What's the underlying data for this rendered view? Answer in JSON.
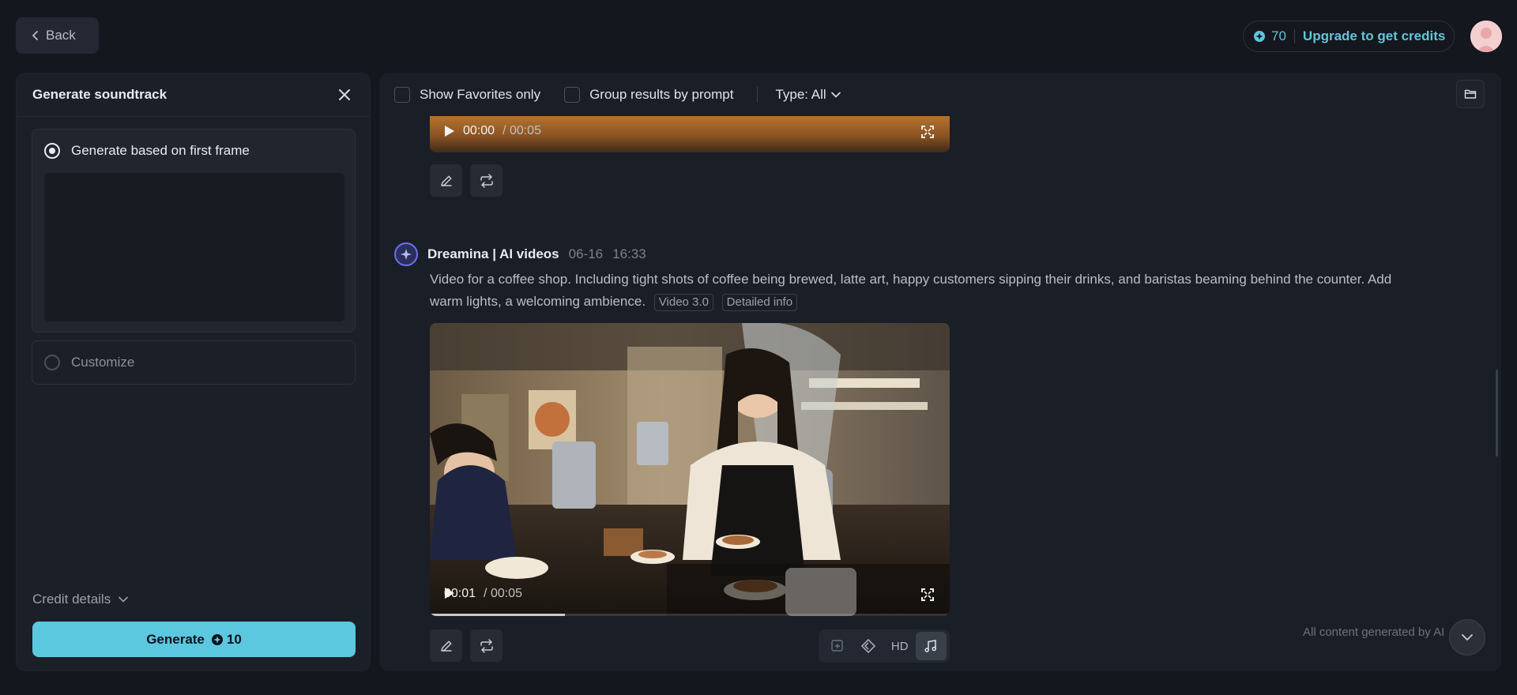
{
  "topbar": {
    "back_label": "Back",
    "credits_count": "70",
    "upgrade_label": "Upgrade to get credits"
  },
  "left_panel": {
    "title": "Generate soundtrack",
    "option_first_frame": "Generate based on first frame",
    "option_customize": "Customize",
    "credit_details_label": "Credit details",
    "generate_label": "Generate",
    "generate_cost": "10"
  },
  "filters": {
    "favorites_label": "Show Favorites only",
    "group_label": "Group results by prompt",
    "type_label": "Type: All"
  },
  "video1": {
    "current": "00:00",
    "duration": "/ 00:05"
  },
  "generation": {
    "name": "Dreamina | AI videos",
    "date": "06-16",
    "time": "16:33",
    "prompt": "Video for a coffee shop. Including tight shots of coffee being brewed, latte art, happy customers sipping their  drinks, and baristas beaming behind the counter. Add warm lights, a welcoming ambience.",
    "model_tag": "Video 3.0",
    "detail_tag": "Detailed info"
  },
  "video2": {
    "current": "00:01",
    "duration": "/ 00:05",
    "progress": 0.26
  },
  "toolbar": {
    "hd_label": "HD"
  },
  "footer_note": "All content generated by AI",
  "colors": {
    "accent": "#5cc8e0",
    "panel": "#1b1f27",
    "background": "#14171d"
  }
}
